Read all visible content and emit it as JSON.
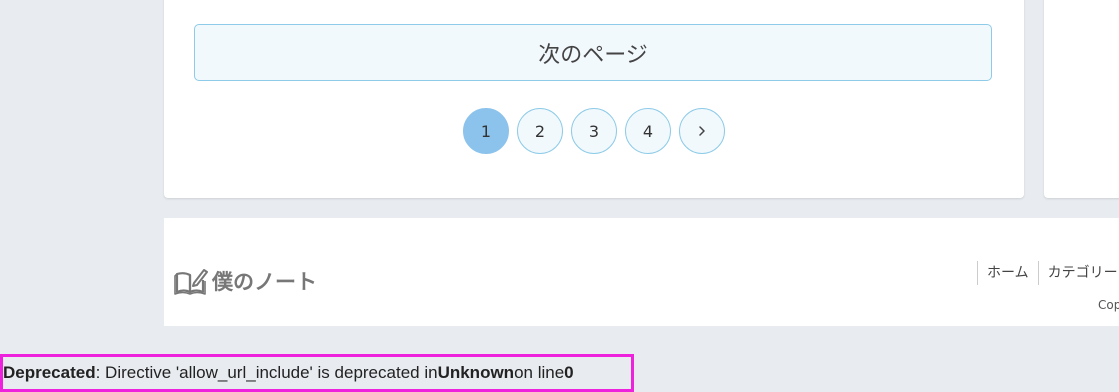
{
  "main": {
    "next_page_label": "次のページ",
    "pagination": {
      "pages": [
        "1",
        "2",
        "3",
        "4"
      ],
      "active_page": "1",
      "next_icon": "chevron-right-icon"
    }
  },
  "footer": {
    "logo_icon": "open-book-pencil-icon",
    "logo_text": "僕のノート",
    "nav": [
      "ホーム",
      "カテゴリー"
    ],
    "copyright_partial": "Cop"
  },
  "warning": {
    "label": "Deprecated",
    "message_part1": ": Directive 'allow_url_include' is deprecated in ",
    "file": "Unknown",
    "message_part2": " on line ",
    "line": "0"
  },
  "colors": {
    "page_bg": "#e8ecf0",
    "accent_border": "#8ecbe8",
    "accent_fill": "#f2f9fd",
    "active_page": "#8cc3ec",
    "warning_border": "#ee22dd"
  }
}
